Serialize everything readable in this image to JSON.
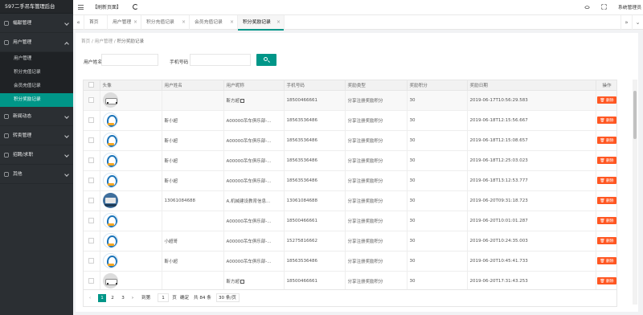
{
  "app": {
    "title": "597二手吊车管理后台"
  },
  "sidebar": {
    "groups": [
      {
        "label": "幅献管理",
        "icon": "monitor-icon"
      },
      {
        "label": "用户管理",
        "icon": "user-icon",
        "open": true
      },
      {
        "label": "新闻动态",
        "icon": "news-icon"
      },
      {
        "label": "转卖管理",
        "icon": "transfer-icon"
      },
      {
        "label": "招聘/求职",
        "icon": "briefcase-icon"
      },
      {
        "label": "其他",
        "icon": "grid-icon"
      }
    ],
    "sub_items": [
      "用户管理",
      "积分充值记录",
      "会员充值记录",
      "积分奖励记录"
    ],
    "active_sub": "积分奖励记录"
  },
  "topbar": {
    "refresh_label": "【刷新页面】",
    "admin_label": "系统管理员"
  },
  "tabs": [
    {
      "label": "首页"
    },
    {
      "label": "用户管理"
    },
    {
      "label": "积分充值记录"
    },
    {
      "label": "会员充值记录"
    },
    {
      "label": "积分奖励记录",
      "active": true
    }
  ],
  "breadcrumb": {
    "home": "首页",
    "sep": "/",
    "level1": "用户管理",
    "current": "积分奖励记录"
  },
  "filters": {
    "username_label": "用户姓名",
    "phone_label": "手机号码",
    "username_value": "",
    "phone_value": ""
  },
  "table": {
    "headers": [
      "",
      "头像",
      "用户姓名",
      "用户昵称",
      "手机号码",
      "奖励类型",
      "奖励积分",
      "奖励日期",
      "操作"
    ],
    "delete_label": "删除",
    "rows": [
      {
        "avatar": "car",
        "name": "",
        "nick": "靳方超",
        "phone": "18500466661",
        "type": "分享注册奖励积分",
        "points": "30",
        "date": "2019-06-17T10:56:29.583"
      },
      {
        "avatar": "logo",
        "name": "靳小超",
        "nick": "A00000吊车俱乐部-...",
        "phone": "18563536486",
        "type": "分享注册奖励积分",
        "points": "30",
        "date": "2019-06-18T12:15:56.667"
      },
      {
        "avatar": "logo",
        "name": "靳小超",
        "nick": "A00000吊车俱乐部-...",
        "phone": "18563536486",
        "type": "分享注册奖励积分",
        "points": "30",
        "date": "2019-06-18T12:15:08.657"
      },
      {
        "avatar": "logo",
        "name": "靳小超",
        "nick": "A00000吊车俱乐部-...",
        "phone": "18563536486",
        "type": "分享注册奖励积分",
        "points": "30",
        "date": "2019-06-18T12:25:03.023"
      },
      {
        "avatar": "logo",
        "name": "靳小超",
        "nick": "A00000吊车俱乐部-...",
        "phone": "18563536486",
        "type": "分享注册奖励积分",
        "points": "30",
        "date": "2019-06-18T13:12:53.777"
      },
      {
        "avatar": "truck",
        "name": "13061084688",
        "nick": "A,机械建设教育信息...",
        "phone": "13061084688",
        "type": "分享注册奖励积分",
        "points": "30",
        "date": "2019-06-20T09:31:18.723"
      },
      {
        "avatar": "logo",
        "name": "",
        "nick": "A00000吊车俱乐部-...",
        "phone": "18500466661",
        "type": "分享注册奖励积分",
        "points": "30",
        "date": "2019-06-20T10:01:01.287"
      },
      {
        "avatar": "logo",
        "name": "小超哥",
        "nick": "A00000吊车俱乐部-...",
        "phone": "15275816662",
        "type": "分享注册奖励积分",
        "points": "30",
        "date": "2019-06-20T10:24:35.003"
      },
      {
        "avatar": "logo",
        "name": "靳小超",
        "nick": "A00000吊车俱乐部-...",
        "phone": "18563536486",
        "type": "分享注册奖励积分",
        "points": "30",
        "date": "2019-06-20T10:45:41.733"
      },
      {
        "avatar": "car",
        "name": "",
        "nick": "靳方超",
        "phone": "18500466661",
        "type": "分享注册奖励积分",
        "points": "30",
        "date": "2019-06-20T17:31:43.253"
      }
    ]
  },
  "pager": {
    "pages": [
      "1",
      "2",
      "3"
    ],
    "current": "1",
    "goto_label": "到第",
    "goto_value": "1",
    "page_unit": "页",
    "confirm_label": "确定",
    "total": "共 84 条",
    "size": "30 条/页"
  }
}
